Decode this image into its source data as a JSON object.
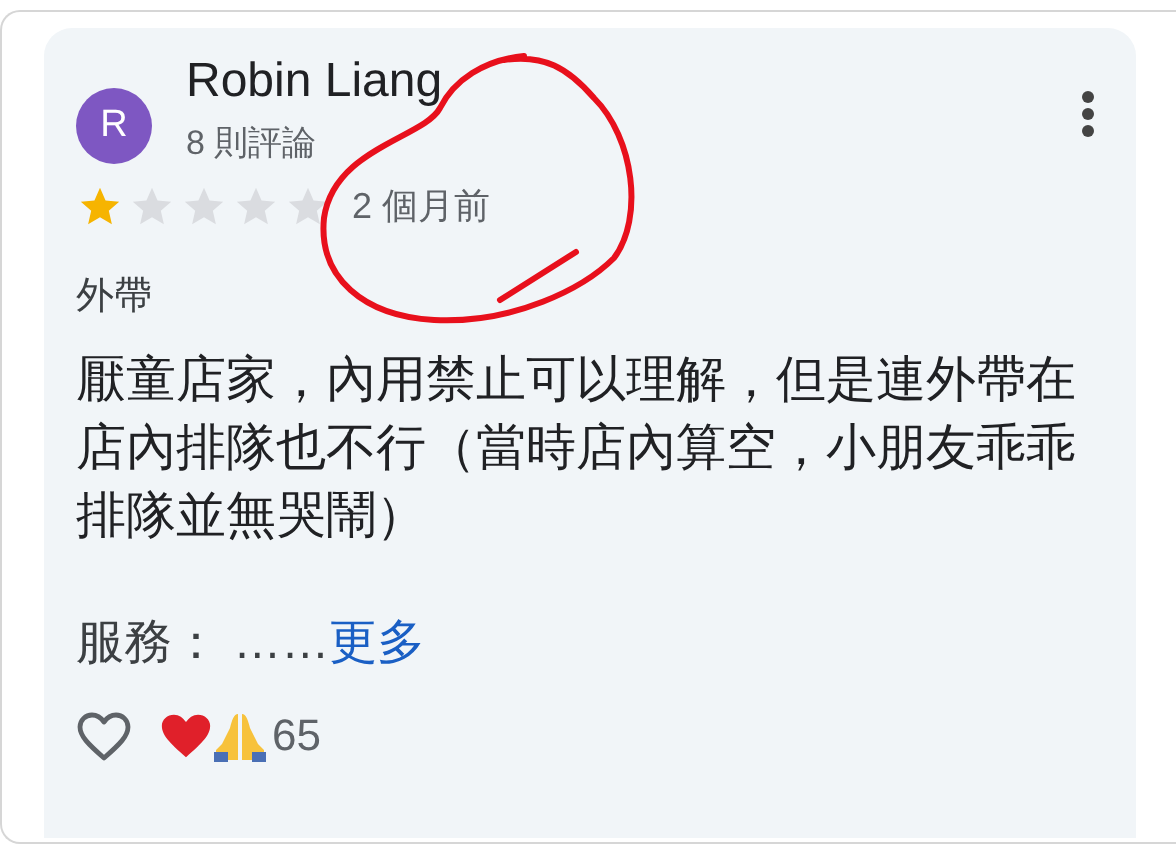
{
  "review": {
    "avatar_letter": "R",
    "author": "Robin Liang",
    "review_count": "8 則評論",
    "stars": 1,
    "time": "2 個月前",
    "tag": "外帶",
    "text": "厭童店家，內用禁止可以理解，但是連外帶在店內排隊也不行（當時店內算空，小朋友乖乖排隊並無哭鬧）",
    "service_label": "服務：",
    "ellipsis": "……",
    "more_link": "更多",
    "reaction_count": "65"
  }
}
